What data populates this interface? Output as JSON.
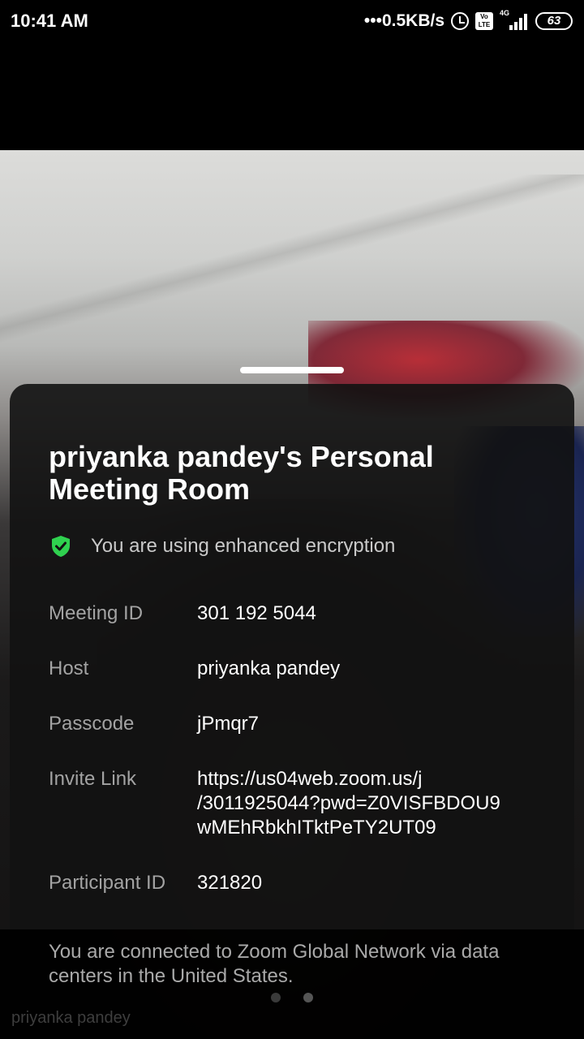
{
  "status_bar": {
    "time": "10:41 AM",
    "net_speed": "•••0.5KB/s",
    "icons": [
      "alarm-icon",
      "volte-icon",
      "signal-4g-icon",
      "battery-icon"
    ],
    "volte_label": "Vo\nLTE",
    "network_type": "4G",
    "battery_level": "63"
  },
  "meeting_sheet": {
    "title": "priyanka pandey's Personal Meeting Room",
    "encryption_text": "You are using enhanced encryption",
    "encryption_icon": "shield-check-icon",
    "encryption_color": "#2fd14f",
    "rows": [
      {
        "label": "Meeting ID",
        "value": "301 192 5044"
      },
      {
        "label": "Host",
        "value": "priyanka pandey"
      },
      {
        "label": "Passcode",
        "value": "jPmqr7"
      },
      {
        "label": "Invite Link",
        "value": "https://us04web.zoom.us/j\n/3011925044?pwd=Z0VISFBDOU9\nwMEhRbkhITktPeTY2UT09"
      },
      {
        "label": "Participant ID",
        "value": "321820"
      }
    ]
  },
  "footer": {
    "network_text": "You are connected to Zoom Global Network via data centers in the United States.",
    "video_name": "priyanka pandey",
    "page_count": 2,
    "active_page": 2
  }
}
